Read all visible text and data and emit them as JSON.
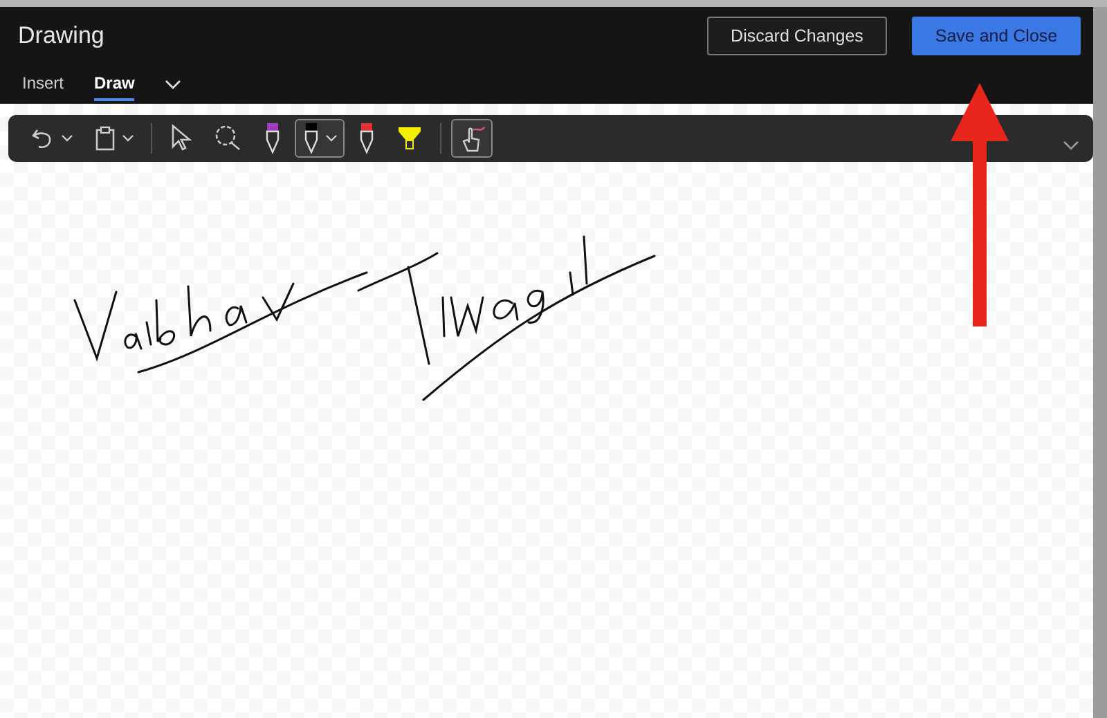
{
  "window": {
    "title": "Drawing"
  },
  "buttons": [
    {
      "label": "Discard Changes",
      "kind": "secondary"
    },
    {
      "label": "Save and Close",
      "kind": "primary"
    }
  ],
  "tabs": [
    {
      "label": "Insert",
      "selected": false
    },
    {
      "label": "Draw",
      "selected": true
    }
  ],
  "toolbar": {
    "groups": [
      [
        {
          "kind": "undo",
          "selected": false,
          "dropdown": true
        },
        {
          "kind": "paste",
          "selected": false,
          "dropdown": true
        }
      ],
      [
        {
          "kind": "select",
          "selected": false,
          "dropdown": false
        },
        {
          "kind": "lasso",
          "selected": false,
          "dropdown": false
        },
        {
          "kind": "pen",
          "selected": false,
          "dropdown": false,
          "color": "#a03ac0"
        },
        {
          "kind": "pen",
          "selected": true,
          "dropdown": true,
          "color": "#000000"
        },
        {
          "kind": "pen",
          "selected": false,
          "dropdown": false,
          "color": "#e03030"
        },
        {
          "kind": "highlighter",
          "selected": false,
          "dropdown": false,
          "color": "#f4f000"
        }
      ],
      [
        {
          "kind": "touch",
          "selected": true,
          "dropdown": false
        }
      ]
    ]
  },
  "annotation": {
    "kind": "arrow",
    "color": "#e8261a"
  }
}
